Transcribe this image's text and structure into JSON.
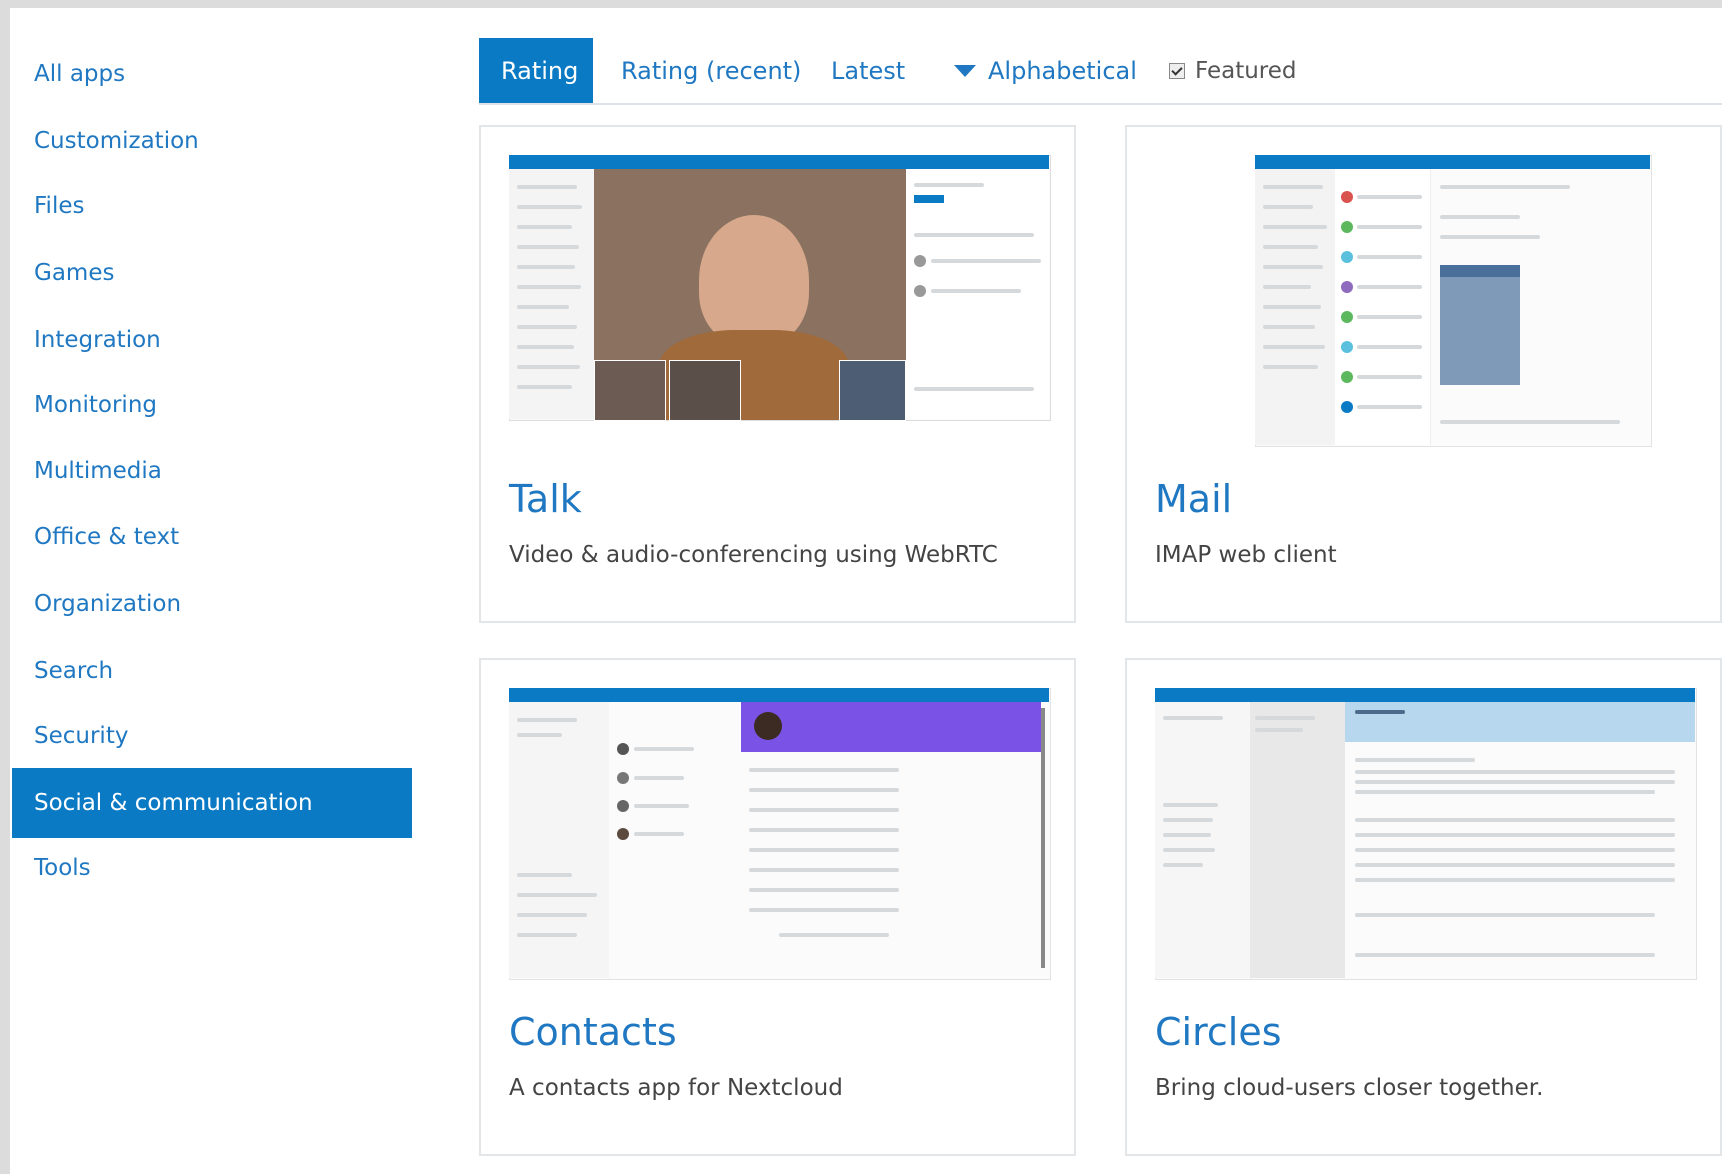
{
  "sidebar": {
    "items": [
      {
        "label": "All apps"
      },
      {
        "label": "Customization"
      },
      {
        "label": "Files"
      },
      {
        "label": "Games"
      },
      {
        "label": "Integration"
      },
      {
        "label": "Monitoring"
      },
      {
        "label": "Multimedia"
      },
      {
        "label": "Office & text"
      },
      {
        "label": "Organization"
      },
      {
        "label": "Search"
      },
      {
        "label": "Security"
      },
      {
        "label": "Social & communication",
        "active": true
      },
      {
        "label": "Tools"
      }
    ]
  },
  "sort_tabs": {
    "rating": "Rating",
    "rating_recent": "Rating (recent)",
    "latest": "Latest",
    "alphabetical": "Alphabetical",
    "featured": "Featured",
    "featured_checked": true
  },
  "apps": [
    {
      "name": "Talk",
      "description": "Video & audio-conferencing using WebRTC"
    },
    {
      "name": "Mail",
      "description": "IMAP web client"
    },
    {
      "name": "Contacts",
      "description": "A contacts app for Nextcloud"
    },
    {
      "name": "Circles",
      "description": "Bring cloud-users closer together."
    }
  ],
  "colors": {
    "accent": "#0a7ac4",
    "link": "#1f78c1"
  }
}
